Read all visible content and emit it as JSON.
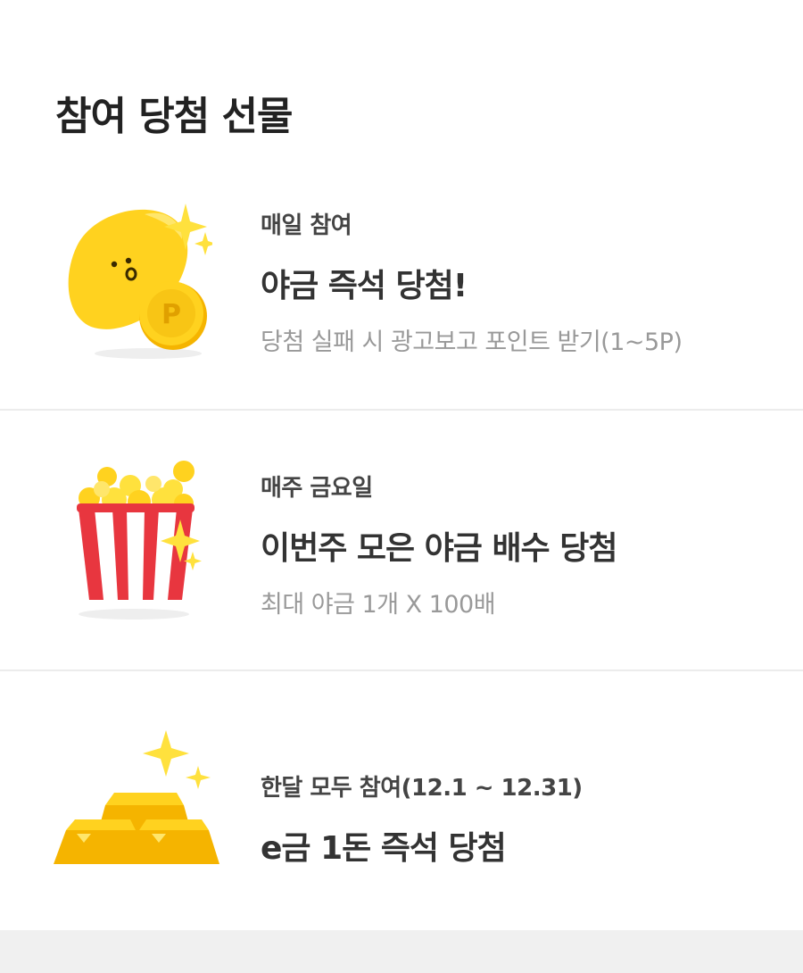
{
  "page": {
    "title": "참여 당첨 선물"
  },
  "rewards": [
    {
      "period": "매일 참여",
      "headline": "야금 즉석 당첨!",
      "description": "당첨 실패 시 광고보고 포인트 받기(1~5P)",
      "icon": "yagum-character-with-coin-icon",
      "coin_letter": "P"
    },
    {
      "period": "매주 금요일",
      "headline": "이번주 모은 야금 배수 당첨",
      "description": "최대 야금 1개 X 100배",
      "icon": "popcorn-bucket-icon"
    },
    {
      "period": "한달 모두 참여(12.1 ~ 12.31)",
      "headline": "e금 1돈 즉석 당첨",
      "icon": "gold-bars-icon"
    }
  ],
  "colors": {
    "gold": "#FFD21F",
    "gold_dark": "#F5B400",
    "popcorn_red": "#E8363F",
    "divider": "#ECECEC",
    "footer_band": "#F0F0F0"
  }
}
